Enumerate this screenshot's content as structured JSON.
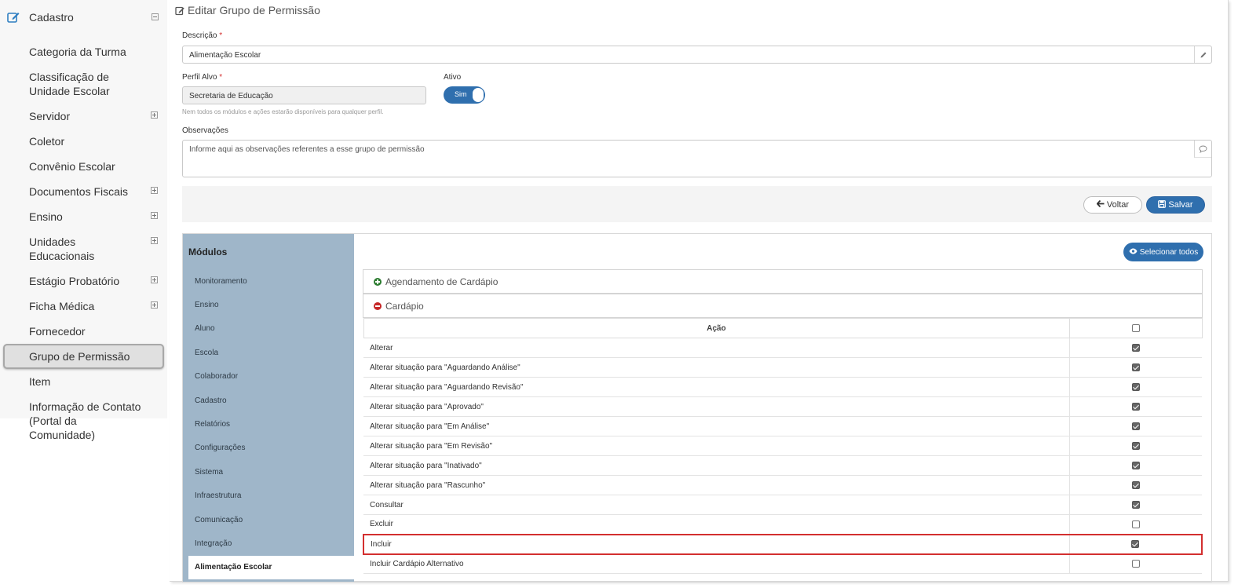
{
  "sidebar": {
    "header": {
      "label": "Cadastro"
    },
    "items": [
      {
        "label": "Categoria da Turma",
        "expandable": false
      },
      {
        "label": "Classificação de Unidade Escolar",
        "expandable": false
      },
      {
        "label": "Servidor",
        "expandable": true
      },
      {
        "label": "Coletor",
        "expandable": false
      },
      {
        "label": "Convênio Escolar",
        "expandable": false
      },
      {
        "label": "Documentos Fiscais",
        "expandable": true
      },
      {
        "label": "Ensino",
        "expandable": true
      },
      {
        "label": "Unidades Educacionais",
        "expandable": true
      },
      {
        "label": "Estágio Probatório",
        "expandable": true
      },
      {
        "label": "Ficha Médica",
        "expandable": true
      },
      {
        "label": "Fornecedor",
        "expandable": false
      },
      {
        "label": "Grupo de Permissão",
        "expandable": false,
        "active": true
      },
      {
        "label": "Item",
        "expandable": false
      },
      {
        "label": "Informação de Contato (Portal da Comunidade)",
        "expandable": false
      }
    ]
  },
  "form": {
    "title": "Editar Grupo de Permissão",
    "descricao_label": "Descrição",
    "descricao_value": "Alimentação Escolar",
    "perfil_label": "Perfil Alvo",
    "perfil_value": "Secretaria de Educação",
    "perfil_hint": "Nem todos os módulos e ações estarão disponíveis para qualquer perfil.",
    "required_mark": "*",
    "ativo_label": "Ativo",
    "ativo_value": "Sim",
    "observacoes_label": "Observações",
    "observacoes_placeholder": "Informe aqui as observações referentes a esse grupo de permissão"
  },
  "actions": {
    "voltar": "Voltar",
    "salvar": "Salvar"
  },
  "modules": {
    "title": "Módulos",
    "items": [
      "Monitoramento",
      "Ensino",
      "Aluno",
      "Escola",
      "Colaborador",
      "Cadastro",
      "Relatórios",
      "Configurações",
      "Sistema",
      "Infraestrutura",
      "Comunicação",
      "Integração",
      "Alimentação Escolar"
    ],
    "active_index": 12
  },
  "permissions": {
    "select_all": "Selecionar todos",
    "groups": [
      {
        "label": "Agendamento de Cardápio",
        "expanded": false
      },
      {
        "label": "Cardápio",
        "expanded": true
      }
    ],
    "table_header": "Ação",
    "rows": [
      {
        "label": "Alterar",
        "checked": true
      },
      {
        "label": "Alterar situação para \"Aguardando Análise\"",
        "checked": true
      },
      {
        "label": "Alterar situação para \"Aguardando Revisão\"",
        "checked": true
      },
      {
        "label": "Alterar situação para \"Aprovado\"",
        "checked": true
      },
      {
        "label": "Alterar situação para \"Em Análise\"",
        "checked": true
      },
      {
        "label": "Alterar situação para \"Em Revisão\"",
        "checked": true
      },
      {
        "label": "Alterar situação para \"Inativado\"",
        "checked": true
      },
      {
        "label": "Alterar situação para \"Rascunho\"",
        "checked": true
      },
      {
        "label": "Consultar",
        "checked": true
      },
      {
        "label": "Excluir",
        "checked": false
      },
      {
        "label": "Incluir",
        "checked": true,
        "highlighted": true
      },
      {
        "label": "Incluir Cardápio Alternativo",
        "checked": false
      }
    ]
  },
  "colors": {
    "primary": "#2f6fae",
    "modules_bg": "#9fb6c9",
    "highlight": "#d32f2f"
  }
}
